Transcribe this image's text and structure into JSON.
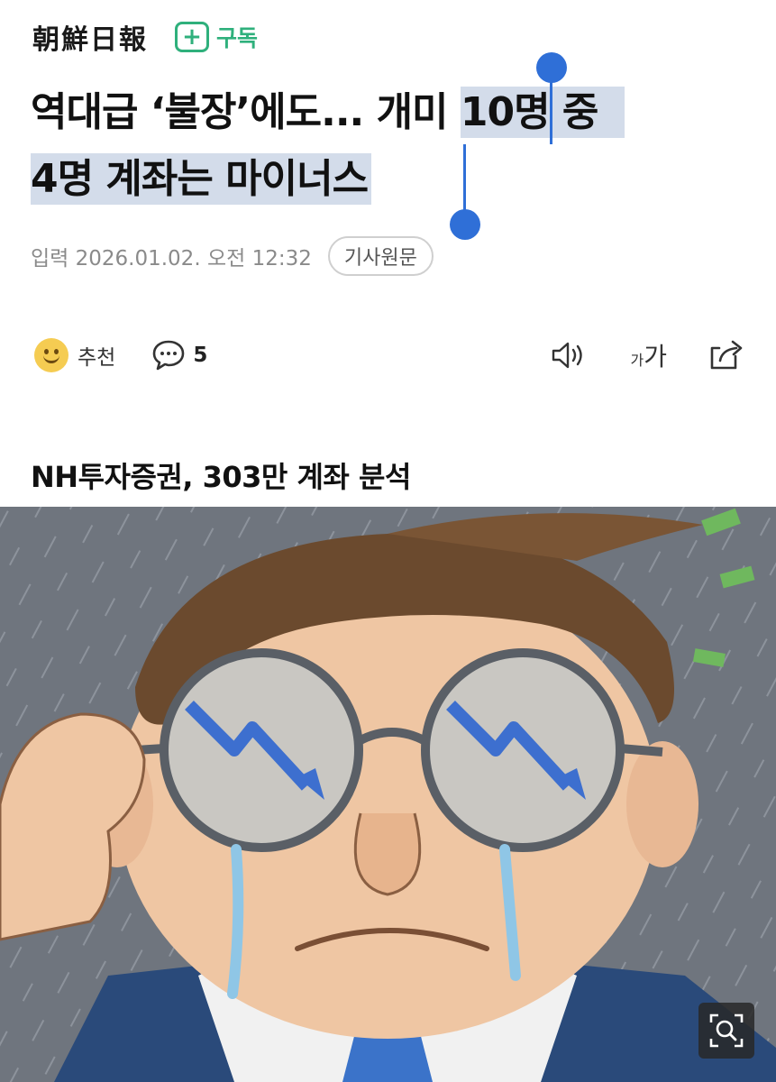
{
  "header": {
    "logo_text": "朝鮮日報",
    "subscribe_label": "구독"
  },
  "article": {
    "headline_line1_plain": "역대급 ‘불장’에도... 개미 ",
    "headline_line1_selected": "10명 중",
    "headline_line2_selected": "4명 계좌는 마이너스",
    "timestamp": "입력 2026.01.02. 오전 12:32",
    "original_button": "기사원문",
    "subheading": "NH투자증권, 303만 계좌 분석"
  },
  "actions": {
    "recommend_label": "추천",
    "comment_count": "5",
    "font_small": "가",
    "font_big": "가"
  },
  "colors": {
    "accent_green": "#2fb07c",
    "selection_bg": "#d3dcea",
    "selection_handle": "#2f6fd7"
  },
  "icons": [
    "plus-icon",
    "smiley-icon",
    "comment-icon",
    "speaker-icon",
    "font-size-icon",
    "share-icon",
    "zoom-icon"
  ]
}
